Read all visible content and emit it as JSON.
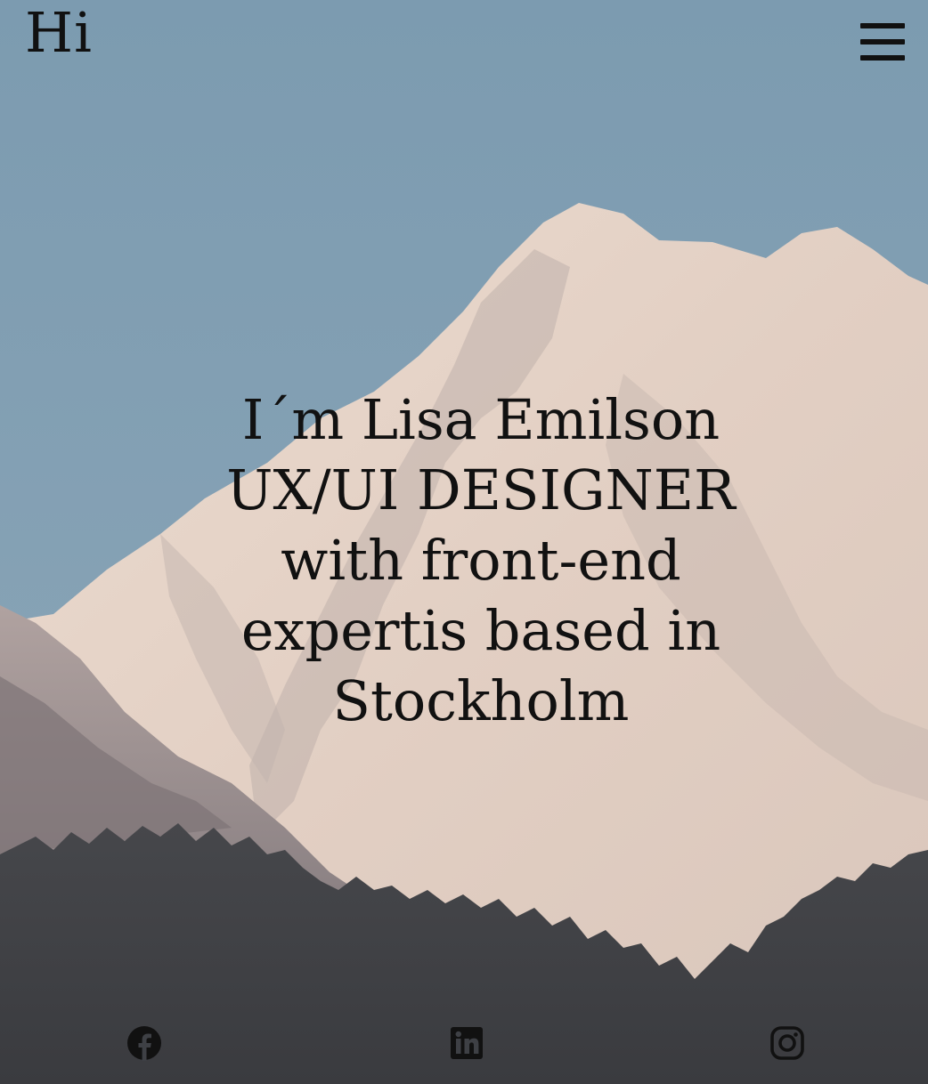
{
  "header": {
    "logo_text": "Hi",
    "menu_icon": "hamburger-menu-icon"
  },
  "hero": {
    "background": "mountain-landscape-photo",
    "headline_lines": [
      "I´m Lisa Emilson",
      "UX/UI DESIGNER",
      "with front-end",
      "expertis based in",
      "Stockholm"
    ]
  },
  "social": {
    "facebook_icon": "facebook-icon",
    "linkedin_icon": "linkedin-icon",
    "instagram_icon": "instagram-icon"
  },
  "colors": {
    "sky": "#7f9fb4",
    "snow": "#e8d8cc",
    "rock_shadow": "#9a8f90",
    "forest": "#3e4045",
    "text": "#111111"
  }
}
